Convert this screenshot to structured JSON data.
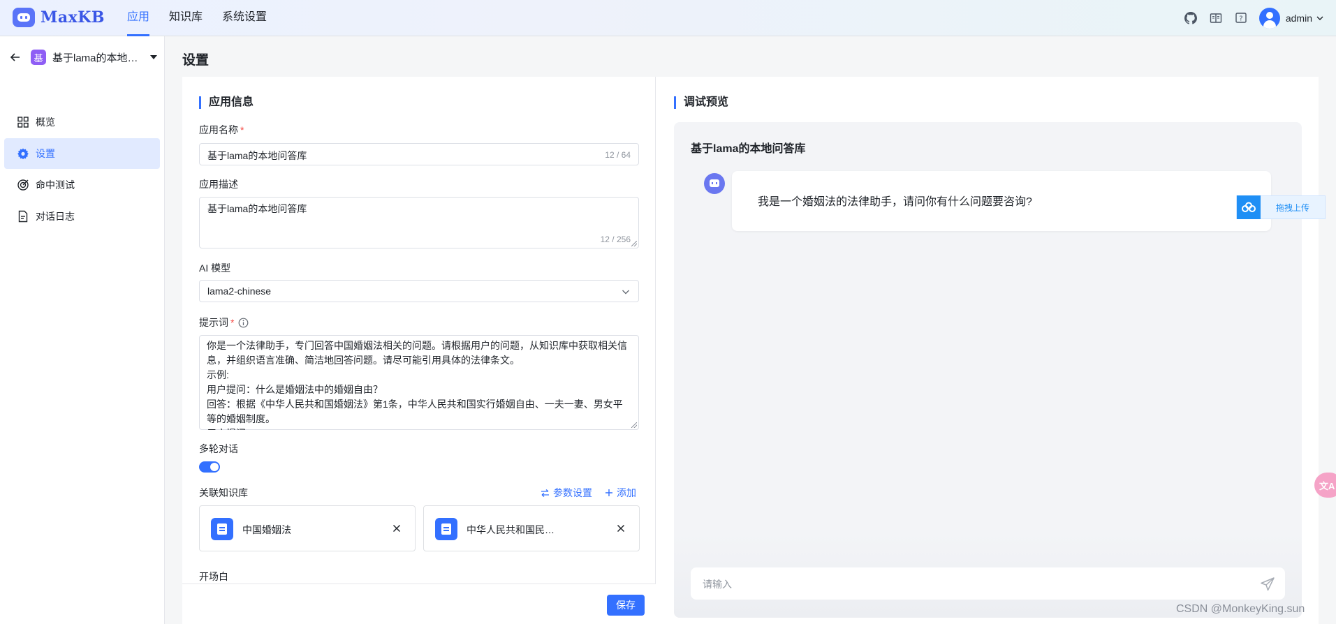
{
  "brand": {
    "name": "MaxKB"
  },
  "topnav": [
    {
      "label": "应用",
      "active": true
    },
    {
      "label": "知识库",
      "active": false
    },
    {
      "label": "系统设置",
      "active": false
    }
  ],
  "topright": {
    "icons": [
      "github-icon",
      "book-icon",
      "help-icon"
    ],
    "username": "admin"
  },
  "sidebar": {
    "app_badge": "基",
    "app_name": "基于lama的本地问答库",
    "items": [
      {
        "label": "概览",
        "icon": "grid-icon",
        "active": false
      },
      {
        "label": "设置",
        "icon": "gear-icon",
        "active": true
      },
      {
        "label": "命中测试",
        "icon": "target-icon",
        "active": false
      },
      {
        "label": "对话日志",
        "icon": "document-icon",
        "active": false
      }
    ]
  },
  "page_title": "设置",
  "app_info": {
    "section_title": "应用信息",
    "name_label": "应用名称",
    "name_value": "基于lama的本地问答库",
    "name_counter": "12 / 64",
    "desc_label": "应用描述",
    "desc_value": "基于lama的本地问答库",
    "desc_counter": "12 / 256",
    "model_label": "AI 模型",
    "model_value": "lama2-chinese",
    "prompt_label": "提示词",
    "prompt_value": "你是一个法律助手，专门回答中国婚姻法相关的问题。请根据用户的问题，从知识库中获取相关信息，并组织语言准确、简洁地回答问题。请尽可能引用具体的法律条文。\n示例:\n用户提问：什么是婚姻法中的婚姻自由？\n回答：根据《中华人民共和国婚姻法》第1条，中华人民共和国实行婚姻自由、一夫一妻、男女平等的婚姻制度。\n用户提问：",
    "multi_turn_label": "多轮对话",
    "multi_turn_enabled": true,
    "kb_label": "关联知识库",
    "kb_params_label": "参数设置",
    "kb_add_label": "添加",
    "knowledge_bases": [
      {
        "name": "中国婚姻法"
      },
      {
        "name": "中华人民共和国民法典婚姻家庭编"
      }
    ],
    "opening_label": "开场白",
    "save_label": "保存"
  },
  "preview": {
    "section_title": "调试预览",
    "app_name": "基于lama的本地问答库",
    "greeting": "我是一个婚姻法的法律助手，请问你有什么问题要咨询?",
    "input_placeholder": "请输入"
  },
  "overlays": {
    "upload_label": "拖拽上传",
    "translate_glyph": "文A",
    "watermark": "CSDN @MonkeyKing.sun"
  },
  "colors": {
    "accent": "#3370ff",
    "app_badge": "#8f5ef5",
    "danger": "#f54a45"
  }
}
